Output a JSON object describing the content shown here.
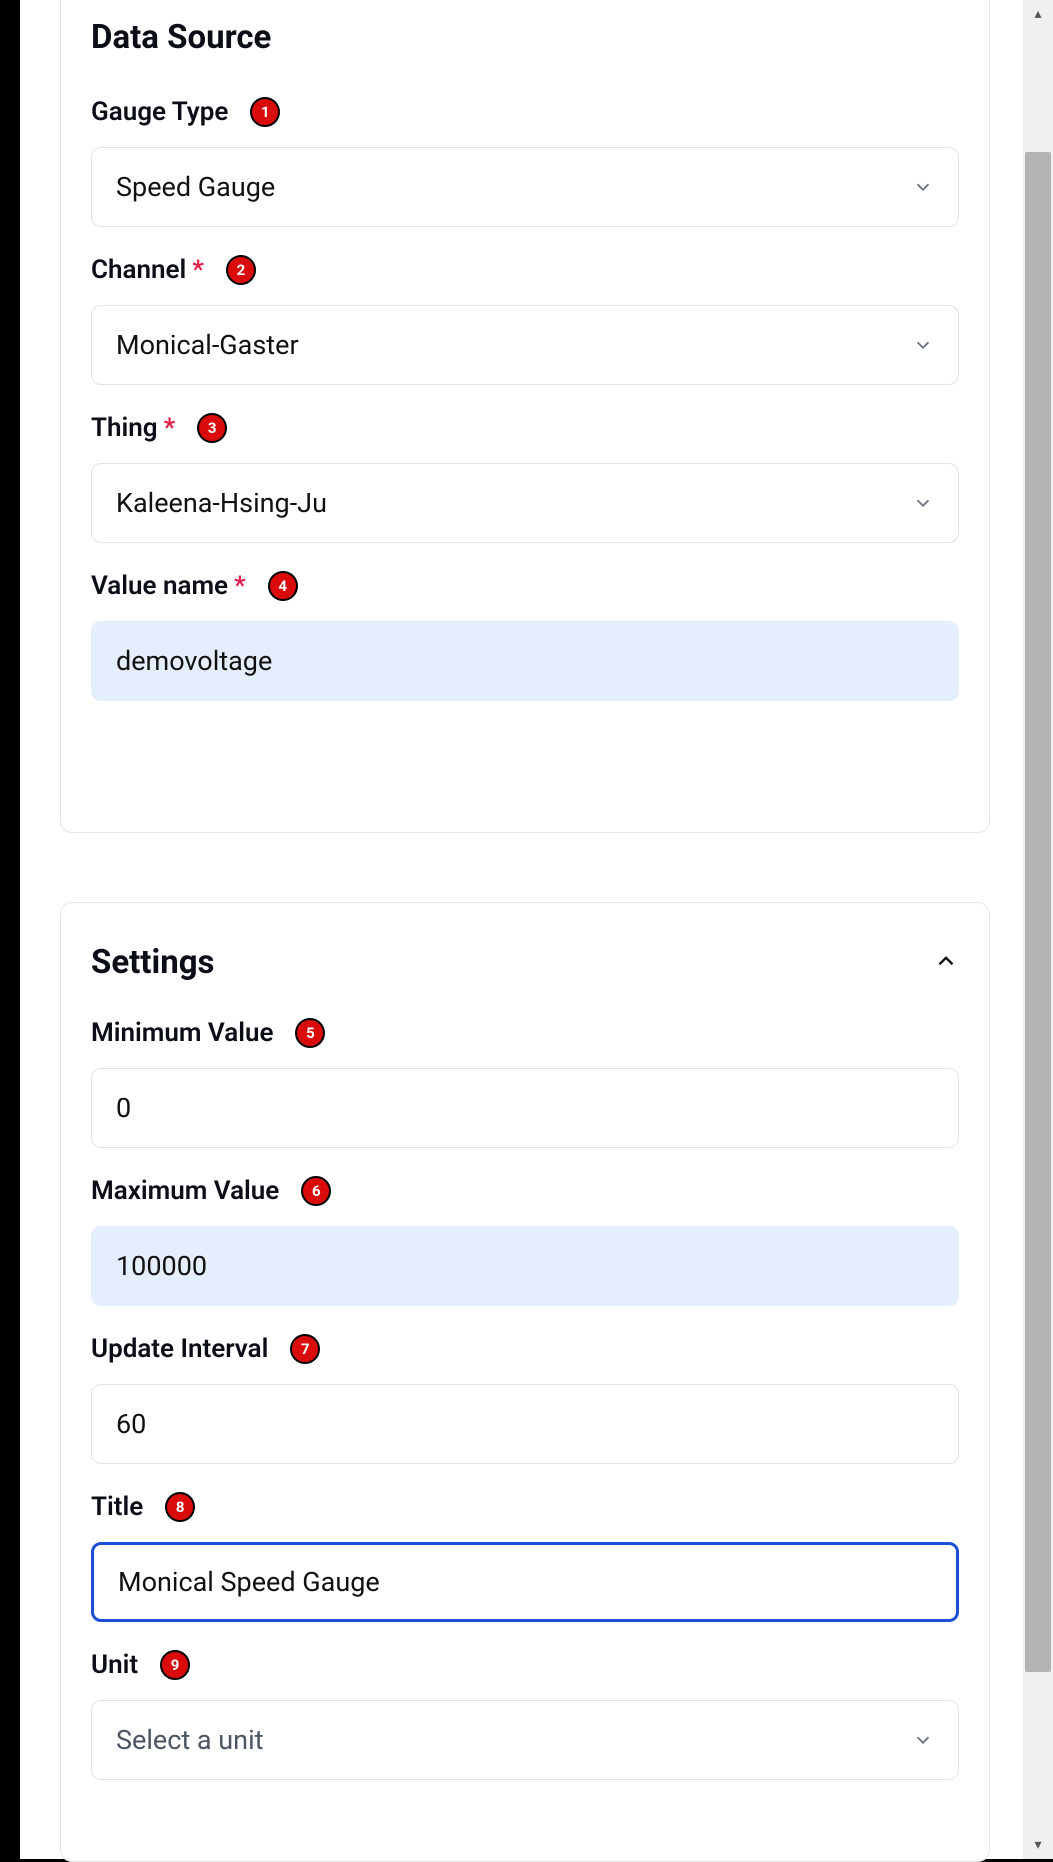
{
  "badges": [
    "1",
    "2",
    "3",
    "4",
    "5",
    "6",
    "7",
    "8",
    "9"
  ],
  "dataSource": {
    "title": "Data Source",
    "gaugeType": {
      "label": "Gauge Type",
      "value": "Speed Gauge"
    },
    "channel": {
      "label": "Channel",
      "value": "Monical-Gaster",
      "required": true
    },
    "thing": {
      "label": "Thing",
      "value": "Kaleena-Hsing-Ju",
      "required": true
    },
    "valueName": {
      "label": "Value name",
      "value": "demovoltage",
      "required": true
    }
  },
  "settings": {
    "title": "Settings",
    "minValue": {
      "label": "Minimum Value",
      "value": "0"
    },
    "maxValue": {
      "label": "Maximum Value",
      "value": "100000"
    },
    "updateInt": {
      "label": "Update Interval",
      "value": "60"
    },
    "titleField": {
      "label": "Title",
      "value": "Monical Speed Gauge"
    },
    "unit": {
      "label": "Unit",
      "placeholder": "Select a unit"
    }
  }
}
